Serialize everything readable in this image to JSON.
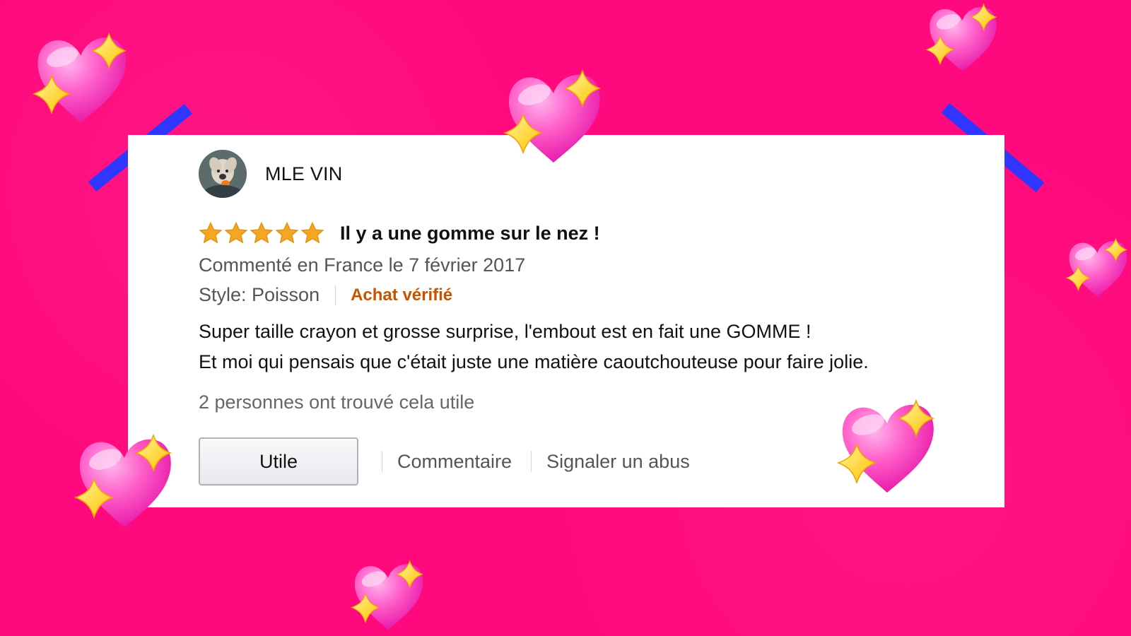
{
  "review": {
    "author": "MLE VIN",
    "rating": 5,
    "title": "Il y a une gomme sur le nez !",
    "date_line": "Commenté en France le 7 février 2017",
    "style": "Style: Poisson",
    "verified": "Achat vérifié",
    "body_lines": [
      "Super taille crayon et grosse surprise, l'embout est en fait une GOMME !",
      "Et moi qui pensais que c'était juste une matière caoutchouteuse pour faire jolie."
    ],
    "helpful_count": "2 personnes ont trouvé cela utile",
    "actions": {
      "helpful_button": "Utile",
      "comment": "Commentaire",
      "report": "Signaler un abus"
    }
  },
  "colors": {
    "background": "#ff0a7e",
    "card": "#ffffff",
    "tape": "#2f36ff",
    "star": "#f5a623",
    "verified": "#c45500",
    "heart": "#ff4fc7",
    "sparkle": "#ffd21f"
  },
  "icons": {
    "avatar": "dog-avatar-icon",
    "star": "star-icon",
    "heart": "sparkling-heart-icon"
  }
}
